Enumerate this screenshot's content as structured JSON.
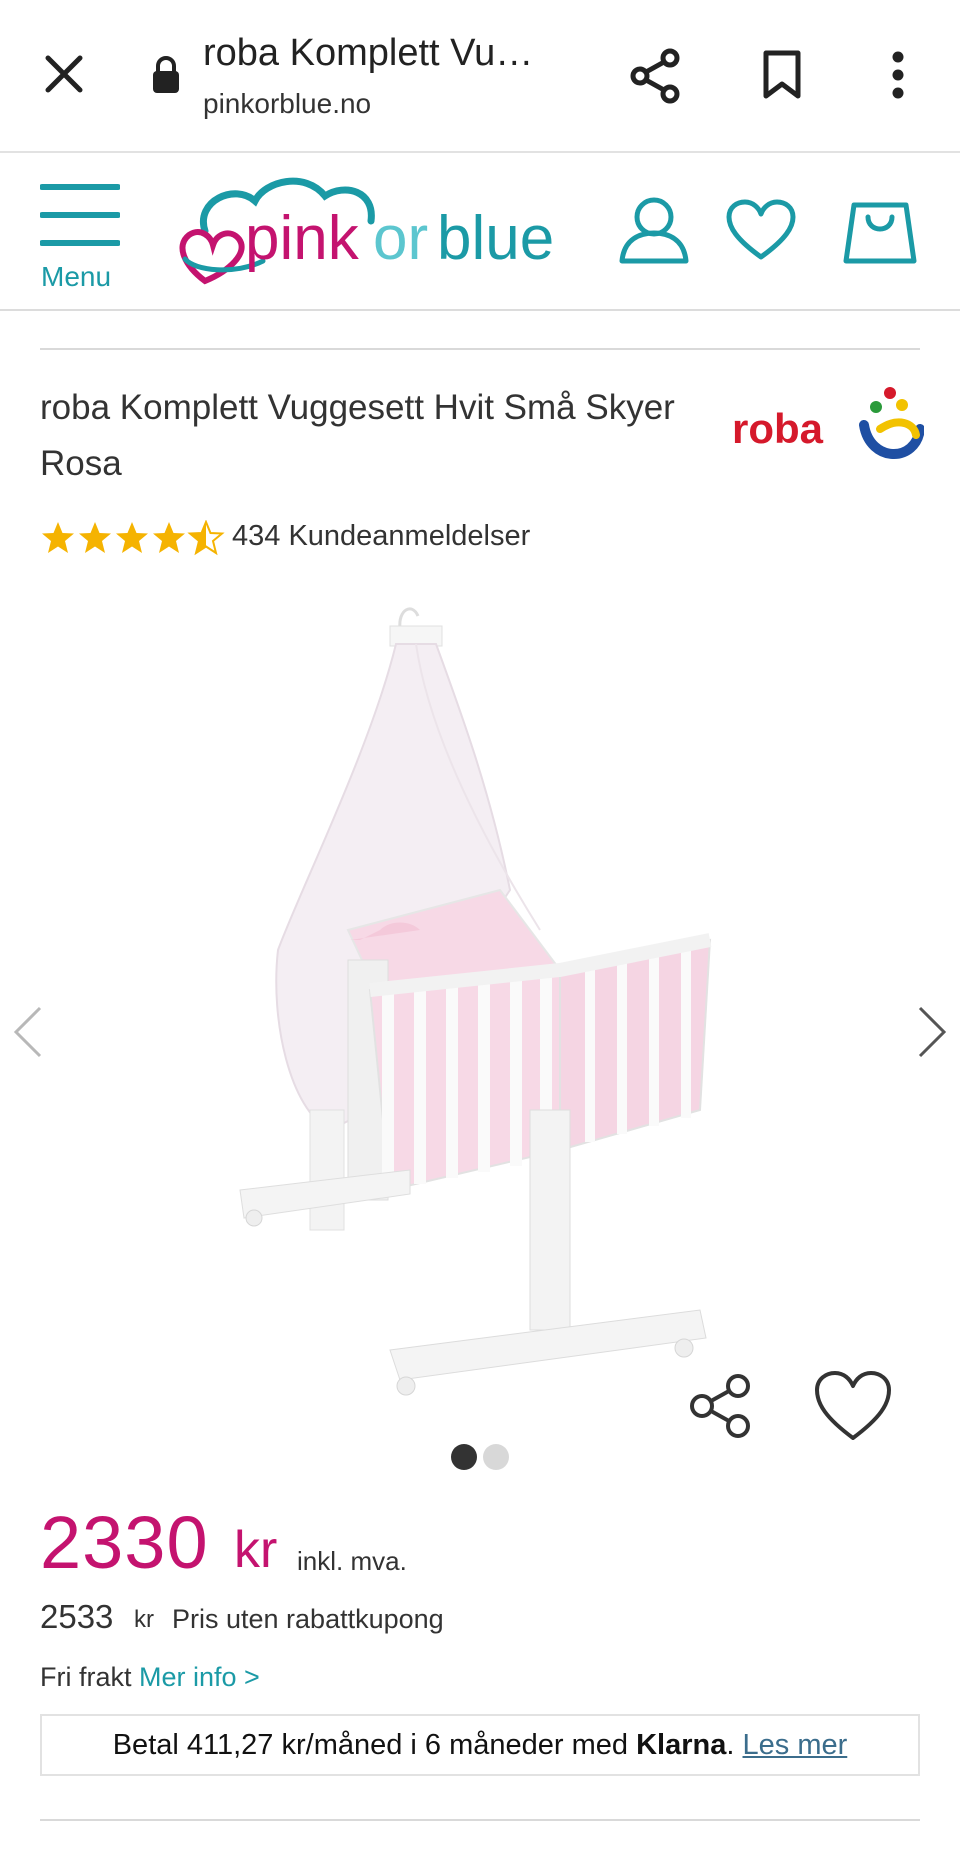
{
  "browser": {
    "tab_title": "roba Komplett Vu…",
    "domain": "pinkorblue.no"
  },
  "header": {
    "menu_label": "Menu",
    "logo_text_pink": "pink",
    "logo_text_or": "or",
    "logo_text_blue": "blue"
  },
  "product": {
    "title": "roba Komplett Vuggesett Hvit Små Skyer Rosa",
    "brand": "roba",
    "rating": 4.5,
    "reviews": "434 Kundeanmeldelser",
    "image_count": 2,
    "active_image": 1
  },
  "pricing": {
    "price": "2330",
    "currency": "kr",
    "vat_note": "inkl. mva.",
    "old_price": "2533",
    "old_currency": "kr",
    "old_note": "Pris uten rabattkupong",
    "shipping": "Fri frakt",
    "more_info": "Mer info >"
  },
  "klarna": {
    "prefix": "Betal 411,27 kr/måned i 6 måneder med",
    "brand": "Klarna",
    "dot": ".",
    "link": "Les mer"
  },
  "colors": {
    "accent_teal": "#1b9aa6",
    "price_pink": "#c4136f",
    "star_yellow": "#f5b301"
  }
}
